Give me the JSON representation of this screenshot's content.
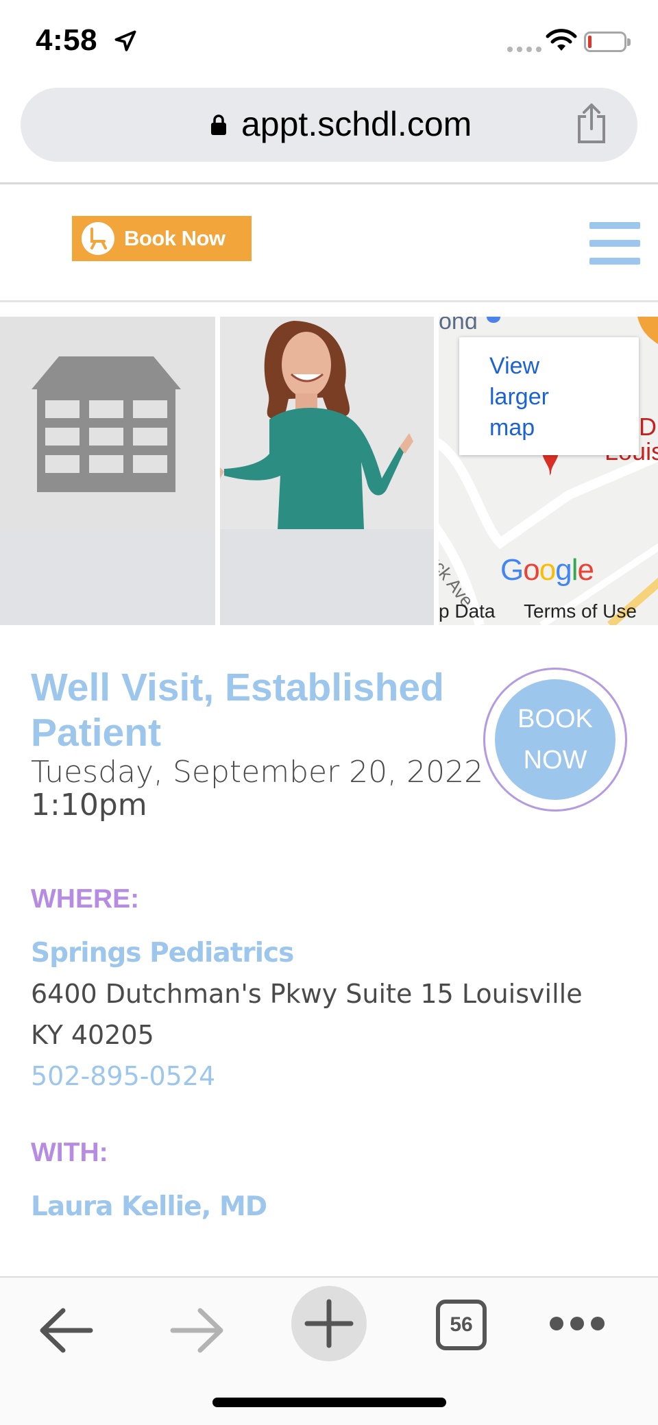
{
  "status_bar": {
    "time": "4:58"
  },
  "browser": {
    "url": "appt.schdl.com",
    "tabs_count": "56"
  },
  "header": {
    "logo_text": "Book Now"
  },
  "map": {
    "popup_link": "View larger map",
    "google_mark": "Google",
    "footer_left": "p Data",
    "footer_right": "Terms of Use",
    "street_label": "lluck Ave",
    "fragment_top": "ond",
    "fragment_right_1": "D",
    "fragment_right_2": "Louisv"
  },
  "appointment": {
    "title": "Well Visit, Established Patient",
    "date": "Tuesday, September 20, 2022",
    "time": "1:10pm",
    "book_button": "BOOK NOW"
  },
  "details": {
    "where_label": "WHERE:",
    "practice_name": "Springs Pediatrics",
    "address": "6400 Dutchman's Pkwy Suite 15 Louisville KY 40205",
    "phone": "502-895-0524",
    "with_label": "WITH:",
    "provider": "Laura Kellie, MD"
  },
  "colors": {
    "accent_blue": "#9dc6ec",
    "accent_purple": "#b58ce2",
    "logo_orange": "#f2a53a",
    "map_link": "#1a62d6"
  },
  "icons": [
    "location-arrow-icon",
    "wifi-icon",
    "battery-icon",
    "lock-icon",
    "share-icon",
    "menu-icon",
    "building-icon",
    "back-icon",
    "forward-icon",
    "new-tab-icon",
    "tabs-icon",
    "more-icon"
  ]
}
